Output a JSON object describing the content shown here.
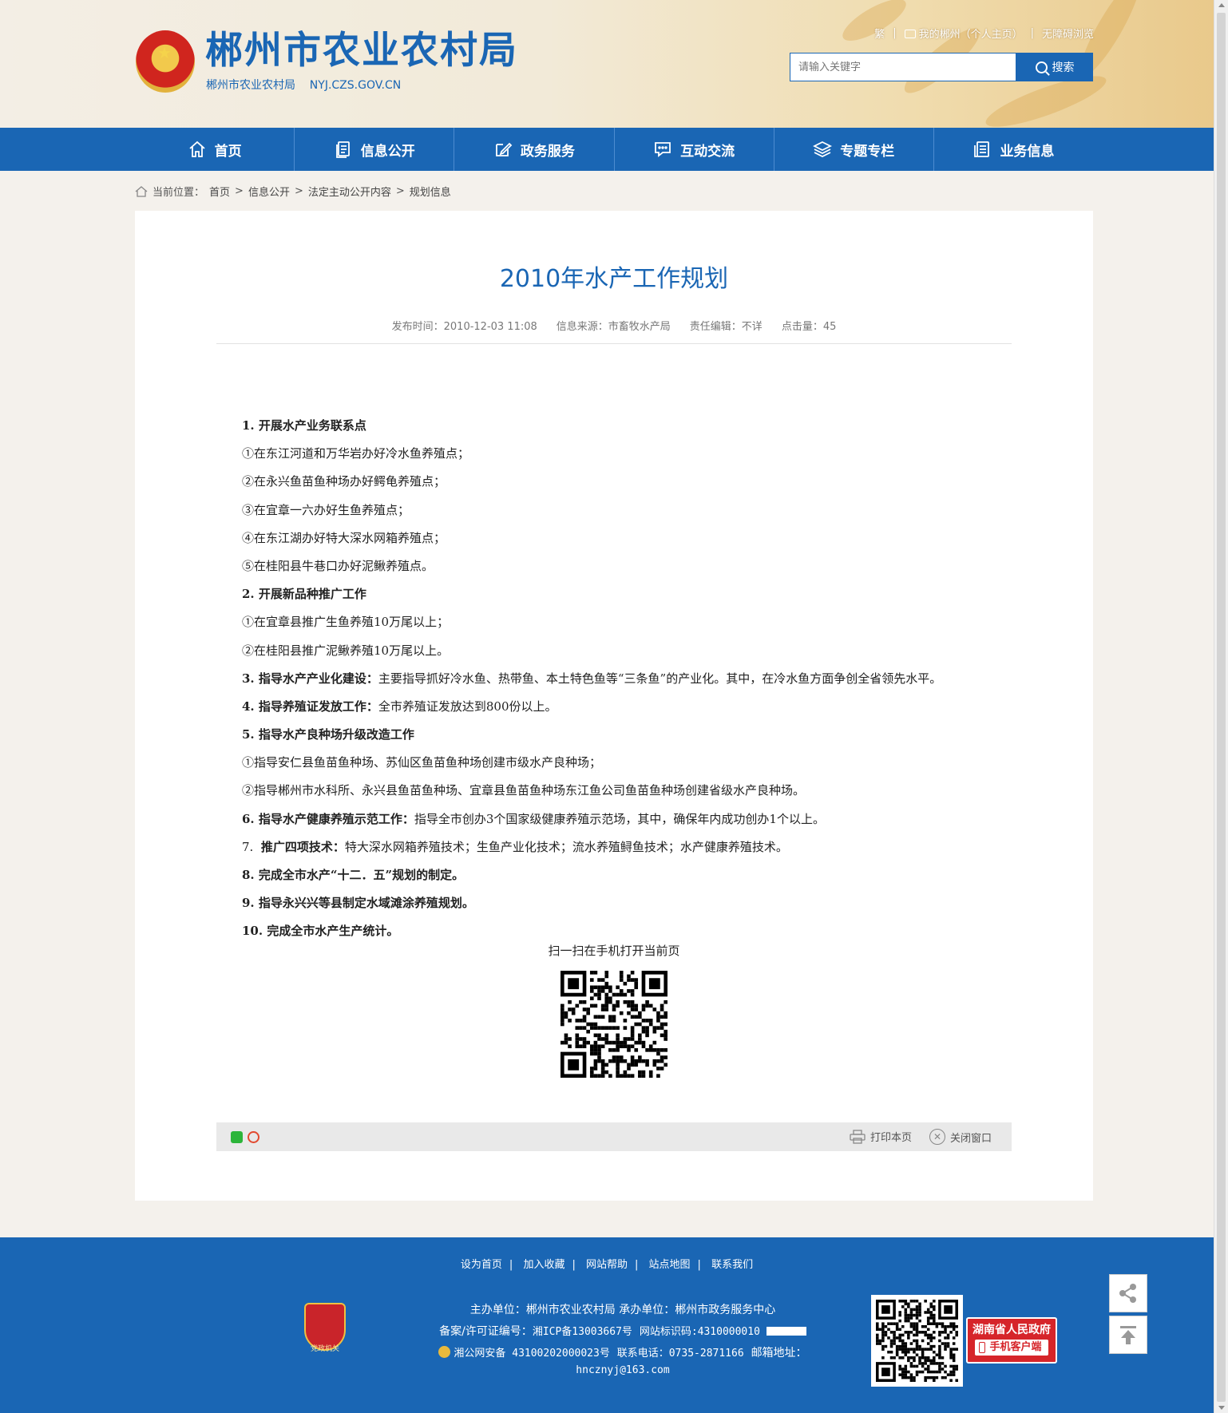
{
  "header": {
    "title": "郴州市农业农村局",
    "subtitle": "郴州市农业农村局    NYJ.CZS.GOV.CN",
    "toplinks": {
      "traditional": "繁",
      "my_chenzhou": "我的郴州（个人主页）",
      "accessibility": "无障碍浏览"
    },
    "search": {
      "placeholder": "请输入关键字",
      "button": "搜索"
    }
  },
  "nav": {
    "items": [
      {
        "label": "首页",
        "icon": "home-icon"
      },
      {
        "label": "信息公开",
        "icon": "document-icon"
      },
      {
        "label": "政务服务",
        "icon": "edit-icon"
      },
      {
        "label": "互动交流",
        "icon": "chat-icon"
      },
      {
        "label": "专题专栏",
        "icon": "layers-icon"
      },
      {
        "label": "业务信息",
        "icon": "file-list-icon"
      }
    ]
  },
  "breadcrumb": {
    "prefix": "当前位置：",
    "items": [
      "首页",
      "信息公开",
      "法定主动公开内容",
      "规划信息"
    ],
    "separator": ">"
  },
  "article": {
    "title": "2010年水产工作规划",
    "meta": {
      "publish_time": "发布时间：2010-12-03 11:08",
      "source": "信息来源：市畜牧水产局",
      "editor": "责任编辑：不详",
      "views": "点击量：45"
    },
    "paragraphs": [
      {
        "bold": "1.  开展水产业务联系点",
        "text": ""
      },
      {
        "bold": "",
        "text": "①在东江河道和万华岩办好冷水鱼养殖点；"
      },
      {
        "bold": "",
        "text": "②在永兴鱼苗鱼种场办好鳄龟养殖点；"
      },
      {
        "bold": "",
        "text": "③在宜章一六办好生鱼养殖点；"
      },
      {
        "bold": "",
        "text": "④在东江湖办好特大深水网箱养殖点；"
      },
      {
        "bold": "",
        "text": "⑤在桂阳县牛巷口办好泥鳅养殖点。"
      },
      {
        "bold": "2.  开展新品种推广工作",
        "text": ""
      },
      {
        "bold": "",
        "text": "①在宜章县推广生鱼养殖10万尾以上；"
      },
      {
        "bold": "",
        "text": "②在桂阳县推广泥鳅养殖10万尾以上。"
      },
      {
        "bold": "3.  指导水产产业化建设：",
        "text": "主要指导抓好冷水鱼、热带鱼、本土特色鱼等“三条鱼”的产业化。其中，在冷水鱼方面争创全省领先水平。"
      },
      {
        "bold": "4.  指导养殖证发放工作：",
        "text": "全市养殖证发放达到800份以上。"
      },
      {
        "bold": "5.  指导水产良种场升级改造工作",
        "text": ""
      },
      {
        "bold": "",
        "text": "①指导安仁县鱼苗鱼种场、苏仙区鱼苗鱼种场创建市级水产良种场；"
      },
      {
        "bold": "",
        "text": "②指导郴州市水科所、永兴县鱼苗鱼种场、宜章县鱼苗鱼种场东江鱼公司鱼苗鱼种场创建省级水产良种场。"
      },
      {
        "bold": "6.  指导水产健康养殖示范工作：",
        "text": "指导全市创办3个国家级健康养殖示范场，其中，确保年内成功创办1个以上。"
      },
      {
        "bold": "推广四项技术：",
        "prefix": "7.  ",
        "text": "特大深水网箱养殖技术；生鱼产业化技术；流水养殖鲟鱼技术；水产健康养殖技术。"
      },
      {
        "bold": "8.  完成全市水产“十二．五”规划的制定。",
        "text": ""
      },
      {
        "bold": "9.  指导永兴兴等县制定水域滩涂养殖规划。",
        "text": ""
      },
      {
        "bold": "10.  完成全市水产生产统计。",
        "text": ""
      }
    ],
    "qr_label": "扫一扫在手机打开当前页"
  },
  "toolbar": {
    "print": "打印本页",
    "close": "关闭窗口"
  },
  "footer": {
    "links": [
      "设为首页",
      "加入收藏",
      "网站帮助",
      "站点地图",
      "联系我们"
    ],
    "badge_text": "党政机关",
    "line1": "主办单位：郴州市农业农村局  承办单位：郴州市政务服务中心",
    "line2_label": "备案/许可证编号：",
    "icp": "湘ICP备13003667号",
    "site_id": "网站标识码:4310000010",
    "police": "湘公网安备 43100202000023号",
    "phone": "联系电话：0735-2871166",
    "email_label": "邮箱地址：",
    "email": "hncznyj@163.com",
    "app_line1": "湖南省人民政府",
    "app_line2": "手机客户端"
  }
}
